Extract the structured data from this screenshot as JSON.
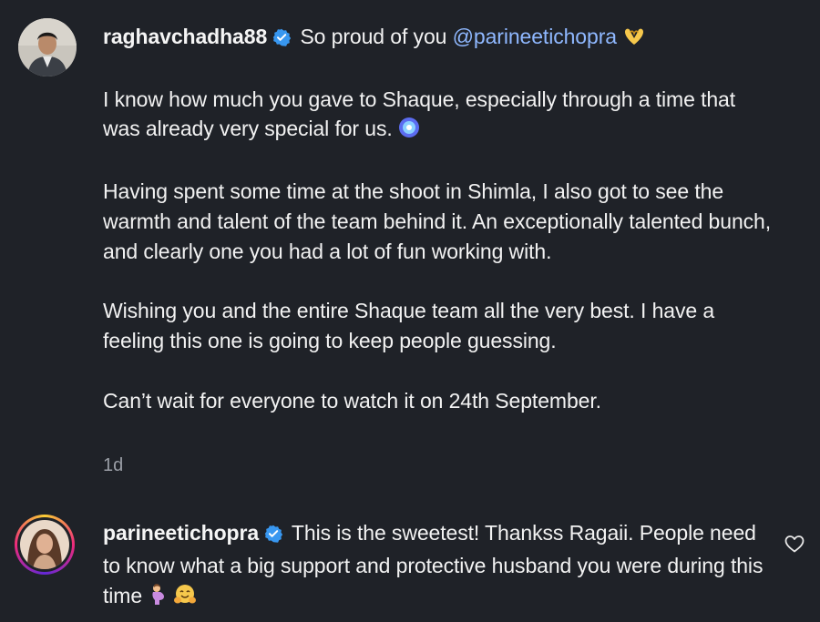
{
  "comments": [
    {
      "username": "raghavchadha88",
      "intro": "So proud of you",
      "mention": "@parineetichopra",
      "intro_emoji": "heart-hands-emoji",
      "paragraphs": [
        "I know how much you gave to Shaque, especially through a time that was already very special for us.",
        "Having spent some time at the shoot in Shimla, I also got to see the warmth and talent of the team behind it. An exceptionally talented bunch, and clearly one you had a lot of fun working with.",
        "Wishing you and the entire Shaque team all the very best. I have a feeling this one is going to keep people guessing.",
        "Can’t wait for everyone to watch it on 24th September."
      ],
      "time": "1d"
    },
    {
      "username": "parineetichopra",
      "text": "This is the sweetest! Thankss Ragaii. People need to know what a big support and protective husband you were during this time",
      "trailing_emojis": [
        "pregnant-woman-emoji",
        "hugging-face-emoji"
      ],
      "like_icon": "heart-outline-icon"
    }
  ],
  "colors": {
    "background": "#1f2228",
    "mention": "#8fb8ff",
    "verified": "#3897f0",
    "muted": "#9a9ea6"
  }
}
